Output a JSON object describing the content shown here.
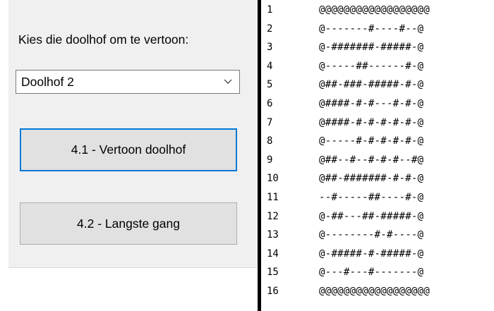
{
  "form": {
    "prompt_label": "Kies die doolhof om te vertoon:",
    "dropdown": {
      "selected": "Doolhof 2",
      "icon": "chevron-down-icon"
    },
    "buttons": {
      "vertoon": "4.1 - Vertoon doolhof",
      "langste": "4.2 - Langste gang"
    }
  },
  "output": {
    "rows": [
      {
        "num": "1",
        "maze": "@@@@@@@@@@@@@@@@@@"
      },
      {
        "num": "2",
        "maze": "@-------#----#--@"
      },
      {
        "num": "3",
        "maze": "@-#######-#####-@"
      },
      {
        "num": "4",
        "maze": "@-----##------#-@"
      },
      {
        "num": "5",
        "maze": "@##-###-#####-#-@"
      },
      {
        "num": "6",
        "maze": "@####-#-#---#-#-@"
      },
      {
        "num": "7",
        "maze": "@####-#-#-#-#-#-@"
      },
      {
        "num": "8",
        "maze": "@-----#-#-#-#-#-@"
      },
      {
        "num": "9",
        "maze": "@##--#--#-#-#--#@"
      },
      {
        "num": "10",
        "maze": "@##-#######-#-#-@"
      },
      {
        "num": "11",
        "maze": "--#-----##----#-@"
      },
      {
        "num": "12",
        "maze": "@-##---##-#####-@"
      },
      {
        "num": "13",
        "maze": "@--------#-#----@"
      },
      {
        "num": "14",
        "maze": "@-#####-#-#####-@"
      },
      {
        "num": "15",
        "maze": "@---#---#-------@"
      },
      {
        "num": "16",
        "maze": "@@@@@@@@@@@@@@@@@@"
      }
    ]
  }
}
